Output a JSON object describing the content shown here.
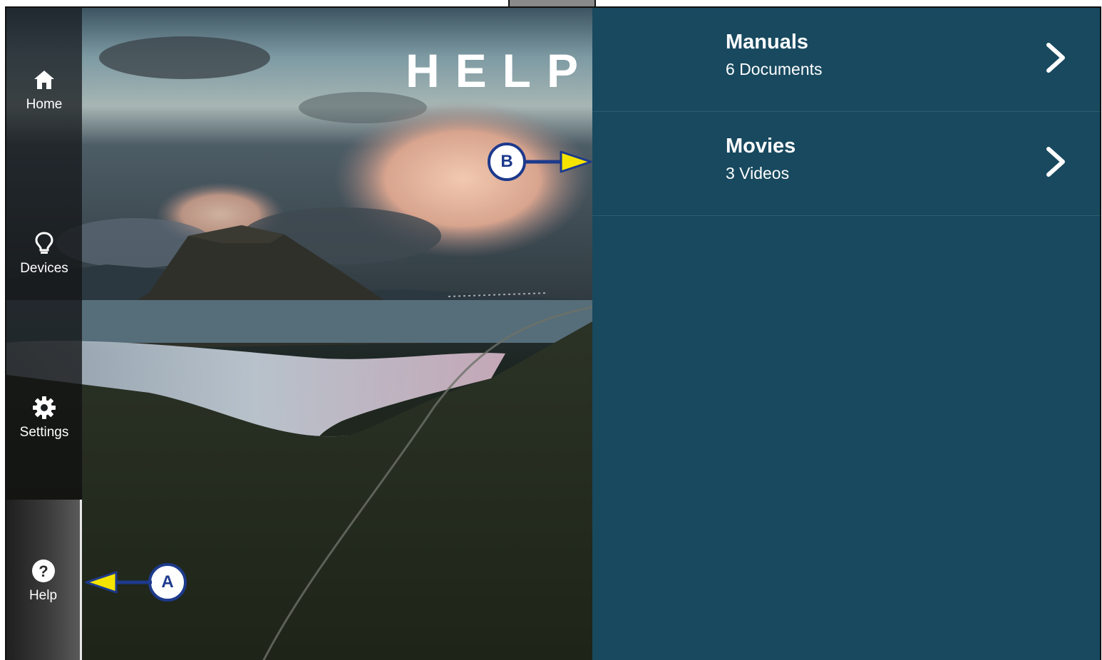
{
  "screen": {
    "title": "HELP"
  },
  "sidebar": {
    "items": [
      {
        "label": "Home",
        "icon": "home-icon"
      },
      {
        "label": "Devices",
        "icon": "lightbulb-icon"
      },
      {
        "label": "Settings",
        "icon": "gear-icon"
      },
      {
        "label": "Help",
        "icon": "help-icon",
        "active": true
      }
    ]
  },
  "help_list": {
    "items": [
      {
        "title": "Manuals",
        "subtitle": "6 Documents",
        "icon": "chevron-right-icon"
      },
      {
        "title": "Movies",
        "subtitle": "3 Videos",
        "icon": "chevron-right-icon"
      }
    ]
  },
  "callouts": {
    "a": "A",
    "b": "B"
  },
  "colors": {
    "panel": "#18495f",
    "callout_border": "#1d3a8c",
    "callout_arrow": "#f5e400"
  }
}
